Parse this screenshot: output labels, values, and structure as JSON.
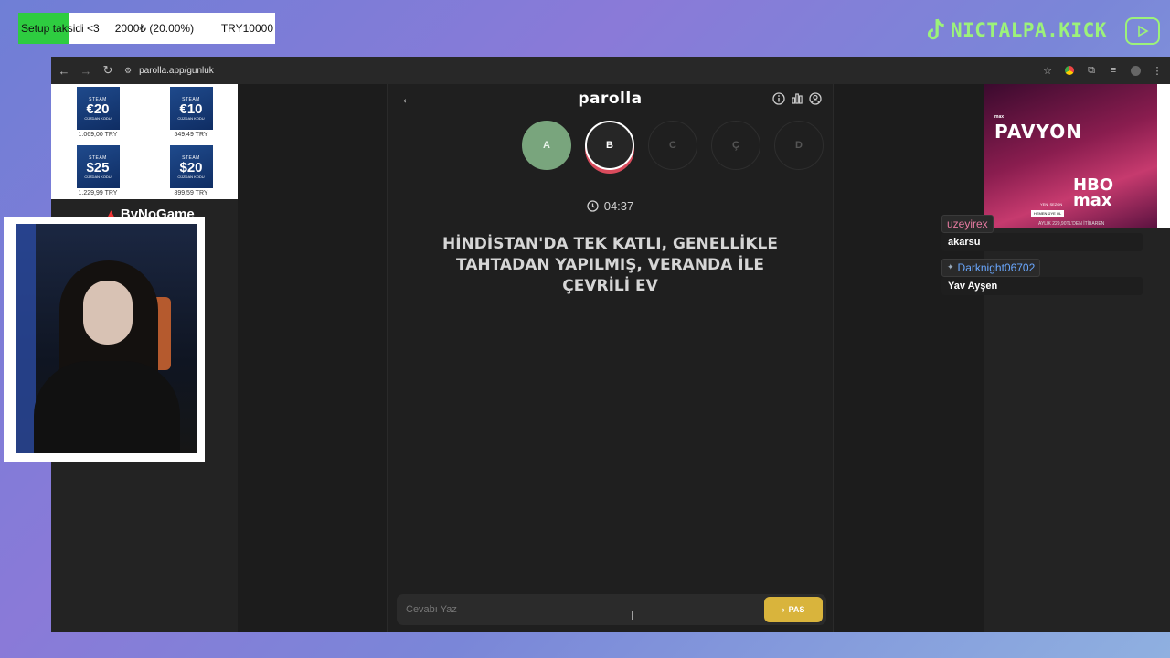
{
  "overlay": {
    "donation": {
      "label": "Setup taksidi <3",
      "amount": "2000₺ (20.00%)",
      "goal": "TRY10000",
      "progress": 0.2
    },
    "brand": "NICTALPA.KICK"
  },
  "browser": {
    "url": "parolla.app/gunluk"
  },
  "left_ads": {
    "cards": [
      {
        "brand": "STEAM",
        "value": "€20",
        "caption": "CÜZDAN KODU",
        "price": "1.069,00 TRY"
      },
      {
        "brand": "STEAM",
        "value": "€10",
        "caption": "CÜZDAN KODU",
        "price": "549,49 TRY"
      },
      {
        "brand": "STEAM",
        "value": "$25",
        "caption": "CÜZDAN KODU",
        "price": "1.229,99 TRY"
      },
      {
        "brand": "STEAM",
        "value": "$20",
        "caption": "CÜZDAN KODU",
        "price": "899,59 TRY"
      }
    ],
    "sponsor": "ByNoGame"
  },
  "game": {
    "title": "parolla",
    "letters": [
      {
        "char": "A",
        "state": "done"
      },
      {
        "char": "B",
        "state": "active"
      },
      {
        "char": "C",
        "state": "pending"
      },
      {
        "char": "Ç",
        "state": "pending"
      },
      {
        "char": "D",
        "state": "pending"
      }
    ],
    "timer": "04:37",
    "question": "HİNDİSTAN'DA TEK KATLI, GENELLİKLE TAHTADAN YAPILMIŞ, VERANDA İLE ÇEVRİLİ EV",
    "answer_placeholder": "Cevabı Yaz",
    "pass_label": "PAS"
  },
  "promo": {
    "tag": "max",
    "title": "PAVYON",
    "subtitle": "YENİ SEZON",
    "cta": "HEMEN ÜYE OL",
    "network": "HBO max",
    "price_note": "AYLIK 229,90TL'DEN İTİBAREN"
  },
  "chat": [
    {
      "user": "uzeyirex",
      "user_color": "#e57aa0",
      "message": "akarsu"
    },
    {
      "user": "Darknight06702",
      "user_color": "#6aa8ff",
      "message": "Yav Ayşen"
    }
  ]
}
